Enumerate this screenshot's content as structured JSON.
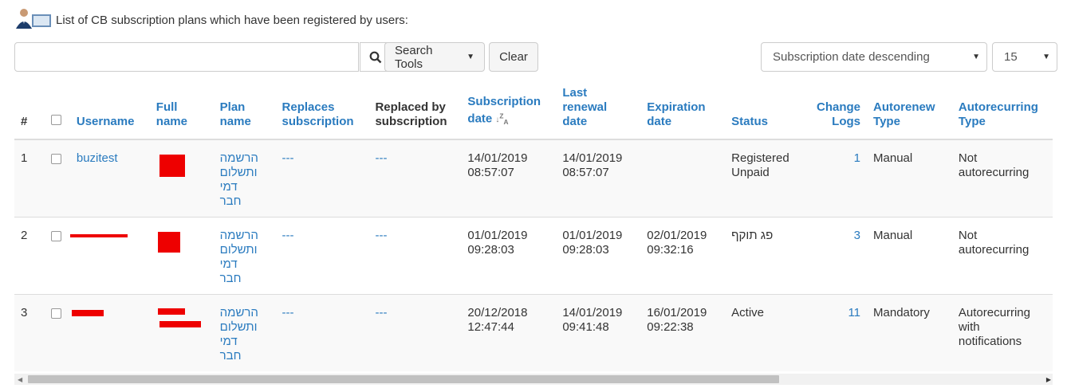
{
  "header": {
    "description": "List of CB subscription plans which have been registered by users:",
    "logo_icon": "users-icon"
  },
  "toolbar": {
    "search_placeholder": "",
    "search_icon": "search-icon",
    "search_tools_label": "Search Tools",
    "clear_label": "Clear",
    "ordering_selected": "Subscription date descending",
    "limit_selected": "15"
  },
  "table": {
    "columns": {
      "num": "#",
      "username": "Username",
      "full_name": [
        "Full",
        "name"
      ],
      "plan_name": [
        "Plan",
        "name"
      ],
      "replaces": [
        "Replaces",
        "subscription"
      ],
      "replaced_by": [
        "Replaced by",
        "subscription"
      ],
      "subscription_date": [
        "Subscription",
        "date"
      ],
      "last_renewal": [
        "Last",
        "renewal",
        "date"
      ],
      "expiration": [
        "Expiration",
        "date"
      ],
      "status": "Status",
      "change_logs": [
        "Change",
        "Logs"
      ],
      "autorenew": [
        "Autorenew",
        "Type"
      ],
      "autorecurring": [
        "Autorecurring",
        "Type"
      ]
    },
    "rows": [
      {
        "num": "1",
        "username": "buzitest",
        "plan_name": [
          "הרשמה",
          "ותשלום",
          "דמי",
          "חבר"
        ],
        "replaces": "---",
        "replaced_by": "---",
        "subscription_date": [
          "14/01/2019",
          "08:57:07"
        ],
        "last_renewal": [
          "14/01/2019",
          "08:57:07"
        ],
        "expiration": [
          "",
          ""
        ],
        "status": [
          "Registered",
          "Unpaid"
        ],
        "change_logs": "1",
        "autorenew": "Manual",
        "autorecurring": [
          "Not",
          "autorecurring"
        ]
      },
      {
        "num": "2",
        "username": "",
        "plan_name": [
          "הרשמה",
          "ותשלום",
          "דמי",
          "חבר"
        ],
        "replaces": "---",
        "replaced_by": "---",
        "subscription_date": [
          "01/01/2019",
          "09:28:03"
        ],
        "last_renewal": [
          "01/01/2019",
          "09:28:03"
        ],
        "expiration": [
          "02/01/2019",
          "09:32:16"
        ],
        "status": [
          "פג תוקף",
          ""
        ],
        "change_logs": "3",
        "autorenew": "Manual",
        "autorecurring": [
          "Not",
          "autorecurring"
        ]
      },
      {
        "num": "3",
        "username": "",
        "plan_name": [
          "הרשמה",
          "ותשלום",
          "דמי",
          "חבר"
        ],
        "replaces": "---",
        "replaced_by": "---",
        "subscription_date": [
          "20/12/2018",
          "12:47:44"
        ],
        "last_renewal": [
          "14/01/2019",
          "09:41:48"
        ],
        "expiration": [
          "16/01/2019",
          "09:22:38"
        ],
        "status": [
          "Active",
          ""
        ],
        "change_logs": "11",
        "autorenew": "Mandatory",
        "autorecurring": [
          "Autorecurring",
          "with",
          "notifications"
        ]
      }
    ]
  },
  "colors": {
    "link": "#2a7bbf",
    "redaction": "#e00000"
  }
}
